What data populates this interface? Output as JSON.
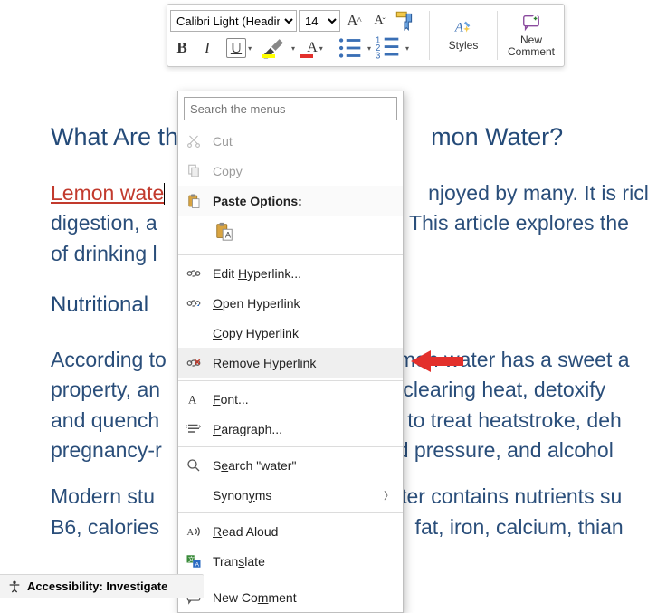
{
  "toolbar": {
    "font_name": "Calibri Light (Heading",
    "font_size": "14",
    "styles_label": "Styles",
    "new_comment_label": "New\nComment"
  },
  "menu": {
    "search_placeholder": "Search the menus",
    "cut": "Cut",
    "copy": "Copy",
    "paste_options": "Paste Options:",
    "edit_hyperlink": "Edit Hyperlink...",
    "open_hyperlink": "Open Hyperlink",
    "copy_hyperlink": "Copy Hyperlink",
    "remove_hyperlink": "Remove Hyperlink",
    "font": "Font...",
    "paragraph": "Paragraph...",
    "search_water": "Search \"water\"",
    "synonyms": "Synonyms",
    "read_aloud": "Read Aloud",
    "translate": "Translate",
    "new_comment": "New Comment"
  },
  "doc": {
    "h1_left": "What Are th",
    "h1_right": "mon Water?",
    "link_text": "Lemon wate",
    "p1_a": "njoyed by many. It is ricl",
    "p1_b": "digestion, a",
    "p1_c": " This article explores the",
    "p1_d": "of drinking l",
    "h2": "Nutritional ",
    "p2_a": "According to",
    "p2_a2": "mon water has a sweet a",
    "p2_b": "property, an",
    "p2_b2": " clearing heat, detoxify",
    "p2_c": "and quench",
    "p2_c2": "to treat heatstroke, deh",
    "p2_d": "pregnancy-r",
    "p2_d2": "d pressure, and alcohol",
    "p3_a": "Modern stu",
    "p3_a2": "ter contains nutrients su",
    "p3_b": "B6, calories",
    "p3_b2": " fat, iron, calcium, thian"
  },
  "status": {
    "accessibility": "Accessibility: Investigate"
  }
}
